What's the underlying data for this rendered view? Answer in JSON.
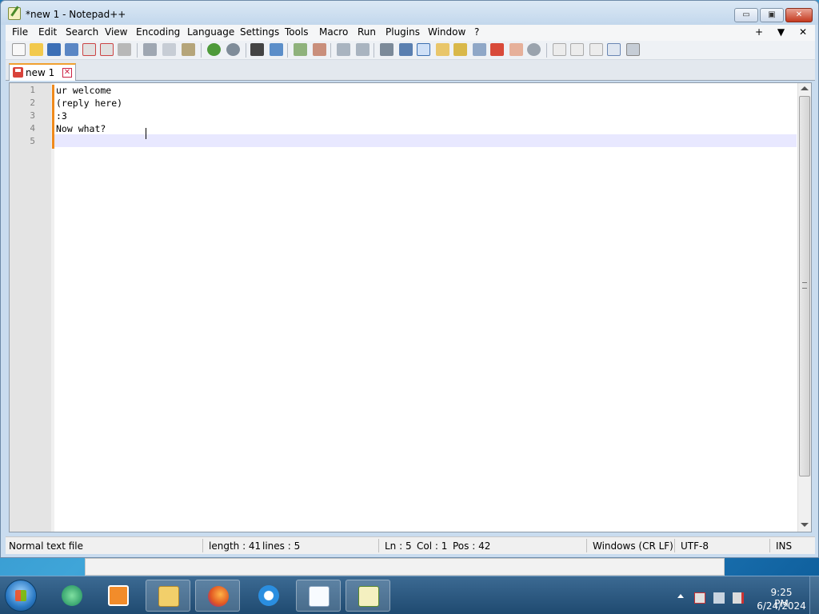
{
  "window": {
    "title": "*new 1 - Notepad++",
    "minimize_glyph": "▭",
    "maximize_glyph": "▣",
    "close_glyph": "✕"
  },
  "menubar": {
    "items": [
      "File",
      "Edit",
      "Search",
      "View",
      "Encoding",
      "Language",
      "Settings",
      "Tools",
      "Macro",
      "Run",
      "Plugins",
      "Window",
      "?"
    ],
    "right_glyphs": [
      "+",
      "▼",
      "✕"
    ]
  },
  "toolbar": {
    "icons": [
      "new-file-icon",
      "open-file-icon",
      "save-icon",
      "save-all-icon",
      "close-icon",
      "close-all-icon",
      "print-icon",
      "cut-icon",
      "copy-icon",
      "paste-icon",
      "undo-icon",
      "redo-icon",
      "find-icon",
      "replace-icon",
      "zoom-in-icon",
      "zoom-out-icon",
      "sync-vertical-icon",
      "sync-horizontal-icon",
      "word-wrap-icon",
      "show-all-chars-icon",
      "indent-guide-icon",
      "user-language-icon",
      "document-map-icon",
      "function-list-icon",
      "folder-workspace-icon",
      "monitoring-icon",
      "record-macro-icon",
      "stop-macro-icon",
      "play-macro-icon",
      "run-macro-multiple-icon",
      "save-macro-icon"
    ]
  },
  "tab": {
    "label": "new 1",
    "close_glyph": "✕"
  },
  "editor": {
    "line_numbers": [
      "1",
      "2",
      "3",
      "4",
      "5"
    ],
    "lines": [
      "ur welcome",
      "(reply here)",
      ":3",
      "Now what?",
      ""
    ]
  },
  "statusbar": {
    "file_type": "Normal text file",
    "length": "length : 41",
    "lines": "lines : 5",
    "ln": "Ln : 5",
    "col": "Col : 1",
    "pos": "Pos : 42",
    "eol": "Windows (CR LF)",
    "encoding": "UTF-8",
    "mode": "INS"
  },
  "taskbar": {
    "apps": [
      "windows-media-center-icon",
      "media-player-icon",
      "file-explorer-icon",
      "firefox-icon",
      "internet-explorer-icon",
      "blank-document-icon",
      "notepad-plus-plus-icon"
    ],
    "time": "9:25 PM",
    "date": "6/24/2024"
  },
  "colors": {
    "accent_orange": "#f08a1c",
    "current_line": "#e8e8ff",
    "taskbar": "#2a5680"
  }
}
